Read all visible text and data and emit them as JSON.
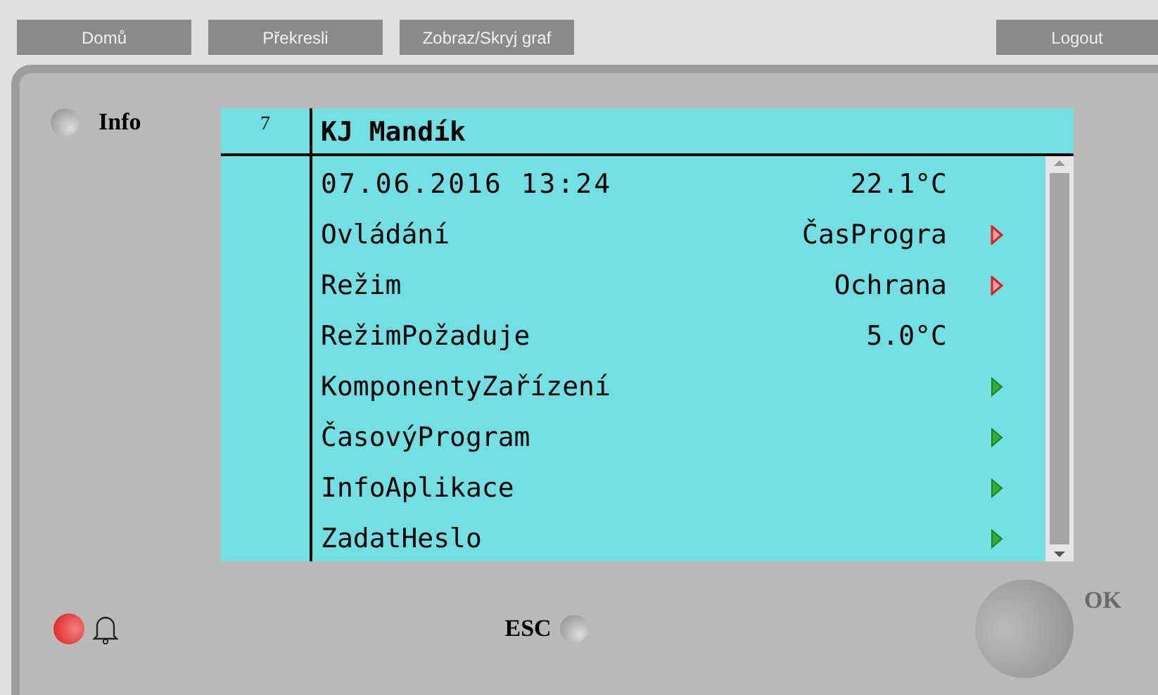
{
  "toolbar": {
    "left_buttons": [
      "Domů",
      "Překresli",
      "Zobraz/Skryj graf"
    ],
    "right_button": "Logout"
  },
  "info": {
    "label": "Info",
    "lit": false
  },
  "display": {
    "line_number": "7",
    "title": "KJ Mandík",
    "rows": [
      {
        "label": "07.06.2016 13:24",
        "value": "22.1°C",
        "kind": "status"
      },
      {
        "label": "Ovládání",
        "value": "ČasProgra",
        "kind": "edit"
      },
      {
        "label": "Režim",
        "value": "Ochrana",
        "kind": "edit"
      },
      {
        "label": "RežimPožaduje",
        "value": "5.0°C",
        "kind": "value"
      },
      {
        "label": "KomponentyZařízení",
        "kind": "submenu"
      },
      {
        "label": "ČasovýProgram",
        "kind": "submenu"
      },
      {
        "label": "InfoAplikace",
        "kind": "submenu"
      },
      {
        "label": "ZadatHeslo",
        "kind": "submenu"
      }
    ]
  },
  "alarm": {
    "lit": true
  },
  "esc": {
    "label": "ESC",
    "lit": false
  },
  "ok": {
    "label": "OK"
  }
}
